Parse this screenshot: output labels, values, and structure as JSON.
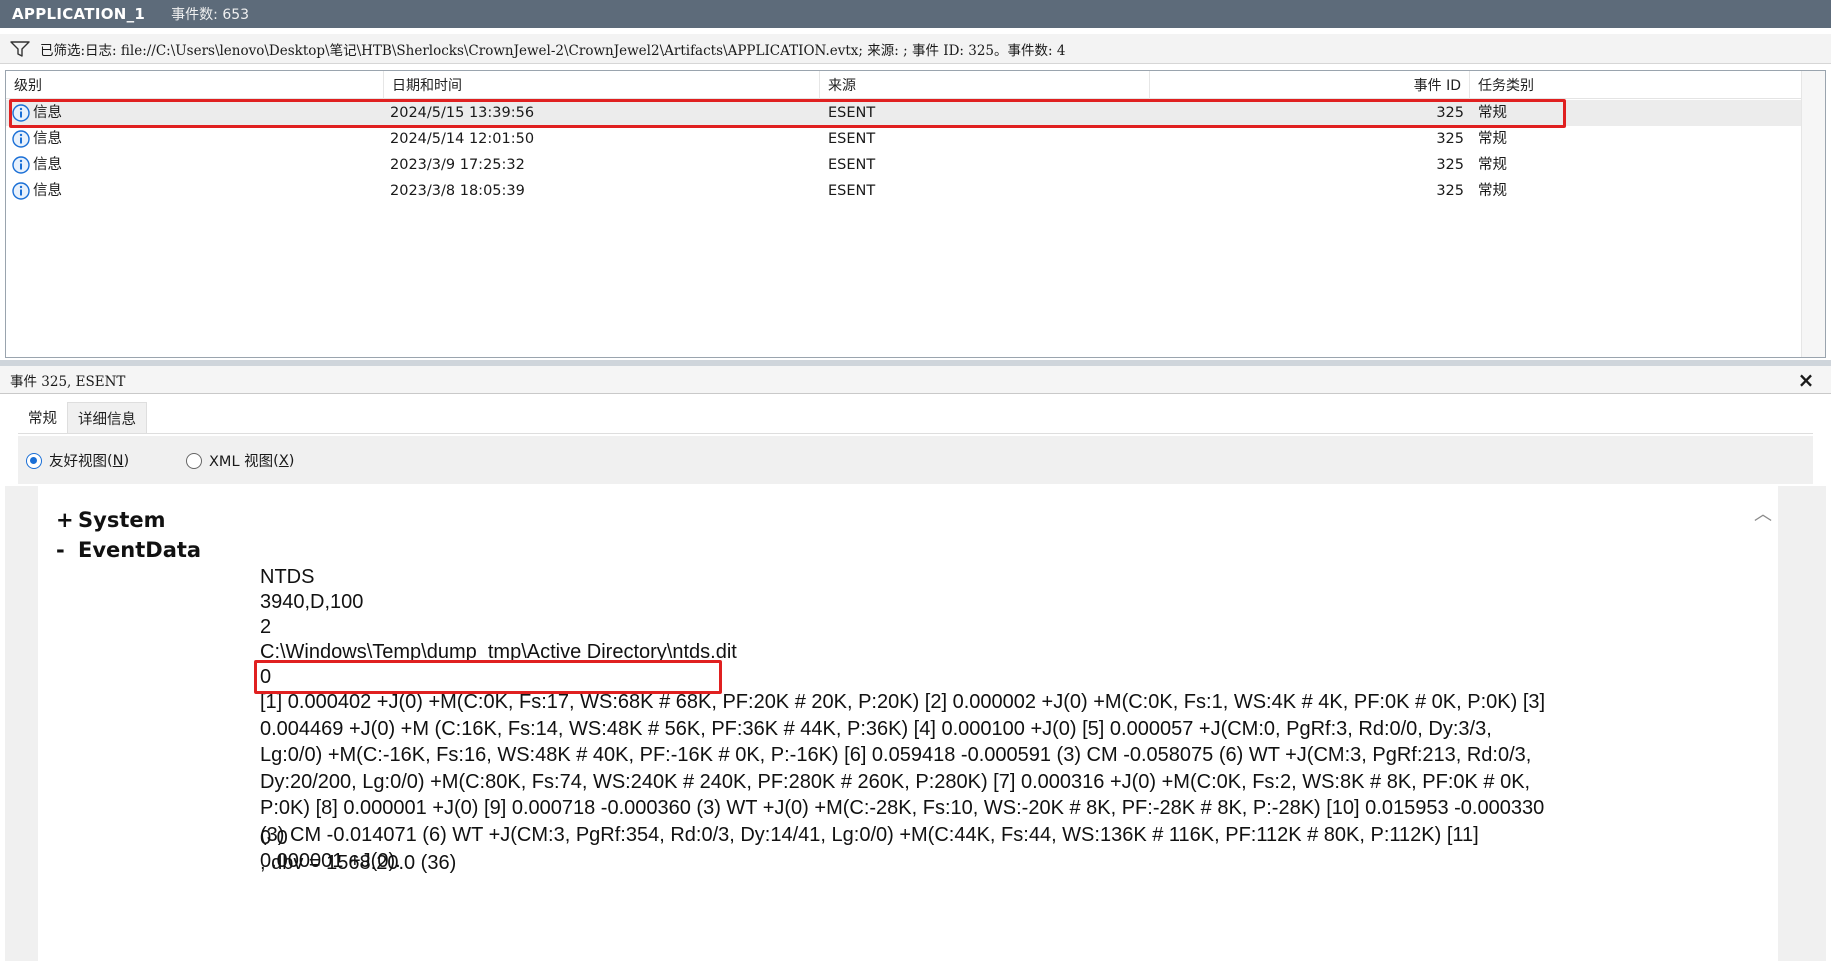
{
  "titlebar": {
    "title": "APPLICATION_1",
    "count": "事件数: 653"
  },
  "filter": {
    "text": "已筛选:日志: file://C:\\Users\\lenovo\\Desktop\\笔记\\HTB\\Sherlocks\\CrownJewel-2\\CrownJewel2\\Artifacts\\APPLICATION.evtx; 来源: ; 事件 ID: 325。事件数: 4"
  },
  "table": {
    "headers": [
      "级别",
      "日期和时间",
      "来源",
      "事件 ID",
      "任务类别"
    ],
    "rows": [
      {
        "level": "信息",
        "datetime": "2024/5/15 13:39:56",
        "source": "ESENT",
        "event_id": "325",
        "category": "常规"
      },
      {
        "level": "信息",
        "datetime": "2024/5/14 12:01:50",
        "source": "ESENT",
        "event_id": "325",
        "category": "常规"
      },
      {
        "level": "信息",
        "datetime": "2023/3/9 17:25:32",
        "source": "ESENT",
        "event_id": "325",
        "category": "常规"
      },
      {
        "level": "信息",
        "datetime": "2023/3/8 18:05:39",
        "source": "ESENT",
        "event_id": "325",
        "category": "常规"
      }
    ]
  },
  "detail": {
    "header": "事件 325, ESENT",
    "close": "×",
    "tabs": [
      "常规",
      "详细信息"
    ],
    "friendly_view": "友好视图",
    "friendly_key": "N",
    "xml_view": "XML 视图",
    "xml_key": "X",
    "system_sign": "+",
    "system_label": "System",
    "eventdata_sign": "-",
    "eventdata_label": "EventData",
    "values": {
      "v1": "NTDS",
      "v2": "3940,D,100",
      "v3": "2",
      "v4": "C:\\Windows\\Temp\\dump_tmp\\Active Directory\\ntds.dit",
      "v5": "0",
      "v6": "[1] 0.000402 +J(0) +M(C:0K, Fs:17, WS:68K # 68K, PF:20K # 20K, P:20K) [2] 0.000002 +J(0) +M(C:0K, Fs:1, WS:4K # 4K, PF:0K # 0K, P:0K) [3] 0.004469 +J(0) +M (C:16K, Fs:14, WS:48K # 56K, PF:36K # 44K, P:36K) [4] 0.000100 +J(0) [5] 0.000057 +J(CM:0, PgRf:3, Rd:0/0, Dy:3/3, Lg:0/0) +M(C:-16K, Fs:16, WS:48K # 40K, PF:-16K # 0K, P:-16K) [6] 0.059418 -0.000591 (3) CM -0.058075 (6) WT +J(CM:3, PgRf:213, Rd:0/3, Dy:20/200, Lg:0/0) +M(C:80K, Fs:74, WS:240K # 240K, PF:280K # 260K, P:280K) [7] 0.000316 +J(0) +M(C:0K, Fs:2, WS:8K # 8K, PF:0K # 0K, P:0K) [8] 0.000001 +J(0) [9] 0.000718 -0.000360 (3) WT +J(0) +M(C:-28K, Fs:10, WS:-20K # 8K, PF:-28K # 8K, P:-28K) [10] 0.015953 -0.000330 (3) CM -0.014071 (6) WT +J(CM:3, PgRf:354, Rd:0/3, Dy:14/41, Lg:0/0) +M(C:44K, Fs:44, WS:136K # 116K, PF:112K # 80K, P:112K) [11] 0.000001 +J(0).",
      "v7": "0 0",
      "v8": ", dbv = 1568.20.0 (36)"
    }
  },
  "icons": {
    "filter": "filter-icon",
    "info": "info-icon",
    "scroll_up": "chevron-up-icon"
  },
  "colors": {
    "highlight": "#e02020",
    "titlebar": "#5d6b7a",
    "info_blue": "#1a6fd6"
  }
}
